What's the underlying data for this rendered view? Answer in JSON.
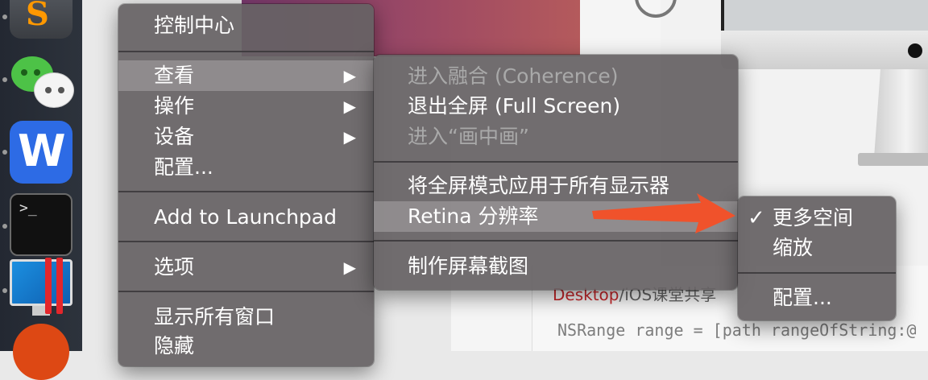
{
  "colors": {
    "menu_bg": "#666264",
    "menu_highlight": "#a9a6a8",
    "disabled_text": "#a9a9a9",
    "annotation_arrow": "#f0522b",
    "dock_bg": "#272c35"
  },
  "dock": {
    "items": [
      {
        "name": "sublime-text-icon",
        "glyph": "S"
      },
      {
        "name": "wechat-icon"
      },
      {
        "name": "wps-icon",
        "glyph": "W"
      },
      {
        "name": "terminal-icon",
        "glyph": ">_"
      },
      {
        "name": "parallels-icon"
      },
      {
        "name": "ubuntu-icon"
      }
    ]
  },
  "main_menu": {
    "items": [
      {
        "label": "控制中心"
      },
      {
        "label": "查看",
        "submenu": true,
        "highlighted": true
      },
      {
        "label": "操作",
        "submenu": true
      },
      {
        "label": "设备",
        "submenu": true
      },
      {
        "label": "配置..."
      },
      {
        "label": "Add to Launchpad"
      },
      {
        "label": "选项",
        "submenu": true
      },
      {
        "label": "显示所有窗口"
      },
      {
        "label": "隐藏"
      }
    ],
    "arrow_glyph": "▶"
  },
  "view_menu": {
    "items": [
      {
        "label": "进入融合 (Coherence)",
        "disabled": true
      },
      {
        "label": "退出全屏 (Full Screen)"
      },
      {
        "label": "进入“画中画”",
        "disabled": true
      },
      {
        "label": "将全屏模式应用于所有显示器"
      },
      {
        "label": "Retina 分辨率",
        "submenu": true,
        "highlighted": true
      },
      {
        "label": "制作屏幕截图"
      }
    ]
  },
  "retina_menu": {
    "check_glyph": "✓",
    "items": [
      {
        "label": "更多空间",
        "checked": true
      },
      {
        "label": "缩放"
      },
      {
        "label": "配置..."
      }
    ]
  },
  "background": {
    "doc_red_word": "Desktop",
    "doc_header_rest": "/iOS课堂共享",
    "code_line": "NSRange range = [path rangeOfString:@"
  }
}
